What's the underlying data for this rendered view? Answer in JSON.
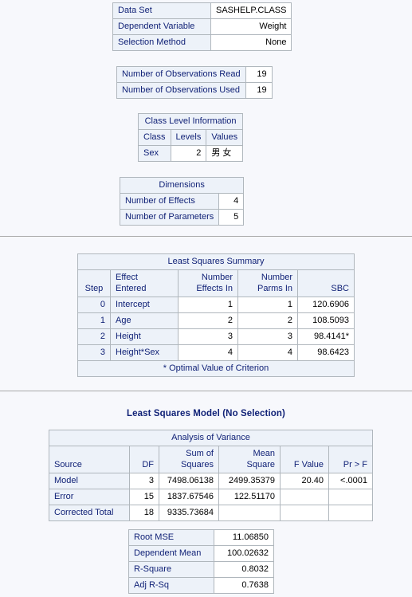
{
  "model_info": {
    "rows": [
      {
        "label": "Data Set",
        "value": "SASHELP.CLASS"
      },
      {
        "label": "Dependent Variable",
        "value": "Weight"
      },
      {
        "label": "Selection Method",
        "value": "None"
      }
    ]
  },
  "observations": {
    "rows": [
      {
        "label": "Number of Observations Read",
        "value": "19"
      },
      {
        "label": "Number of Observations Used",
        "value": "19"
      }
    ]
  },
  "class_level": {
    "caption": "Class Level Information",
    "headers": [
      "Class",
      "Levels",
      "Values"
    ],
    "rows": [
      {
        "class": "Sex",
        "levels": "2",
        "values": "男 女"
      }
    ]
  },
  "dimensions": {
    "caption": "Dimensions",
    "rows": [
      {
        "label": "Number of Effects",
        "value": "4"
      },
      {
        "label": "Number of Parameters",
        "value": "5"
      }
    ]
  },
  "least_squares_summary": {
    "caption": "Least Squares Summary",
    "headers": [
      "Step",
      "Effect Entered",
      "Number Effects In",
      "Number Parms In",
      "SBC"
    ],
    "headers_split": {
      "step": "Step",
      "effect_entered_1": "Effect",
      "effect_entered_2": "Entered",
      "number_effects_in_1": "Number",
      "number_effects_in_2": "Effects In",
      "number_parms_in_1": "Number",
      "number_parms_in_2": "Parms In",
      "sbc": "SBC"
    },
    "rows": [
      {
        "step": "0",
        "effect": "Intercept",
        "effects_in": "1",
        "parms_in": "1",
        "sbc": "120.6906"
      },
      {
        "step": "1",
        "effect": "Age",
        "effects_in": "2",
        "parms_in": "2",
        "sbc": "108.5093"
      },
      {
        "step": "2",
        "effect": "Height",
        "effects_in": "3",
        "parms_in": "3",
        "sbc": "98.4141*"
      },
      {
        "step": "3",
        "effect": "Height*Sex",
        "effects_in": "4",
        "parms_in": "4",
        "sbc": "98.6423"
      }
    ],
    "footnote": "* Optimal Value of Criterion"
  },
  "model_title": "Least Squares Model (No Selection)",
  "anova": {
    "caption": "Analysis of Variance",
    "headers_split": {
      "source": "Source",
      "df": "DF",
      "sum_of_squares_1": "Sum of",
      "sum_of_squares_2": "Squares",
      "mean_square_1": "Mean",
      "mean_square_2": "Square",
      "f_value": "F Value",
      "pr_f": "Pr > F"
    },
    "rows": [
      {
        "source": "Model",
        "df": "3",
        "ss": "7498.06138",
        "ms": "2499.35379",
        "f": "20.40",
        "p": "<.0001"
      },
      {
        "source": "Error",
        "df": "15",
        "ss": "1837.67546",
        "ms": "122.51170",
        "f": "",
        "p": ""
      },
      {
        "source": "Corrected Total",
        "df": "18",
        "ss": "9335.73684",
        "ms": "",
        "f": "",
        "p": ""
      }
    ]
  },
  "fit_statistics": {
    "rows": [
      {
        "label": "Root MSE",
        "value": "11.06850"
      },
      {
        "label": "Dependent Mean",
        "value": "100.02632"
      },
      {
        "label": "R-Square",
        "value": "0.8032"
      },
      {
        "label": "Adj R-Sq",
        "value": "0.7638"
      }
    ]
  }
}
